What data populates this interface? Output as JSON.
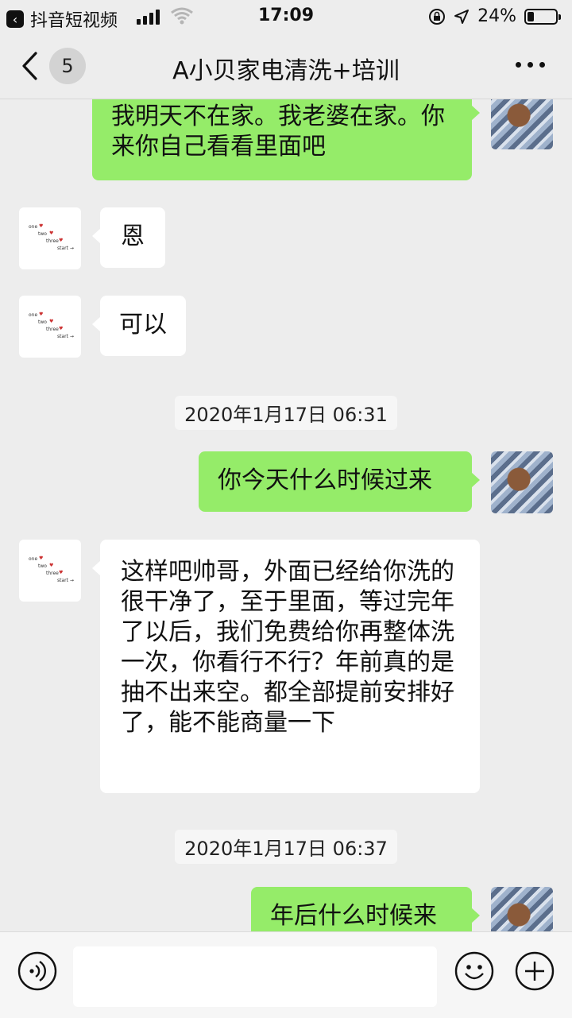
{
  "status_bar": {
    "back_app": "抖音短视频",
    "time": "17:09",
    "battery_percent": "24%",
    "battery_level": 0.24
  },
  "nav": {
    "unread_count": "5",
    "title": "A小贝家电清洗+培训"
  },
  "avatar_other_text": [
    "one",
    "two",
    "three",
    "start →"
  ],
  "messages": [
    {
      "side": "self",
      "text": "我明天不在家。我老婆在家。你来你自己看看里面吧"
    },
    {
      "side": "other",
      "text": "恩"
    },
    {
      "side": "other",
      "text": "可以"
    },
    {
      "side": "time",
      "text": "2020年1月17日 06:31"
    },
    {
      "side": "self",
      "text": "你今天什么时候过来"
    },
    {
      "side": "other",
      "text": "这样吧帅哥，外面已经给你洗的很干净了，至于里面，等过完年了以后，我们免费给你再整体洗一次，你看行不行？年前真的是抽不出来空。都全部提前安排好了，能不能商量一下"
    },
    {
      "side": "time",
      "text": "2020年1月17日 06:37"
    },
    {
      "side": "self",
      "text": "年后什么时候来"
    }
  ],
  "icons": {
    "voice": "voice-icon",
    "emoji": "emoji-icon",
    "plus": "plus-icon",
    "more": "more-icon",
    "back": "chevron-left-icon"
  },
  "colors": {
    "self_bubble": "#95ec69",
    "other_bubble": "#ffffff",
    "background": "#ededed"
  }
}
